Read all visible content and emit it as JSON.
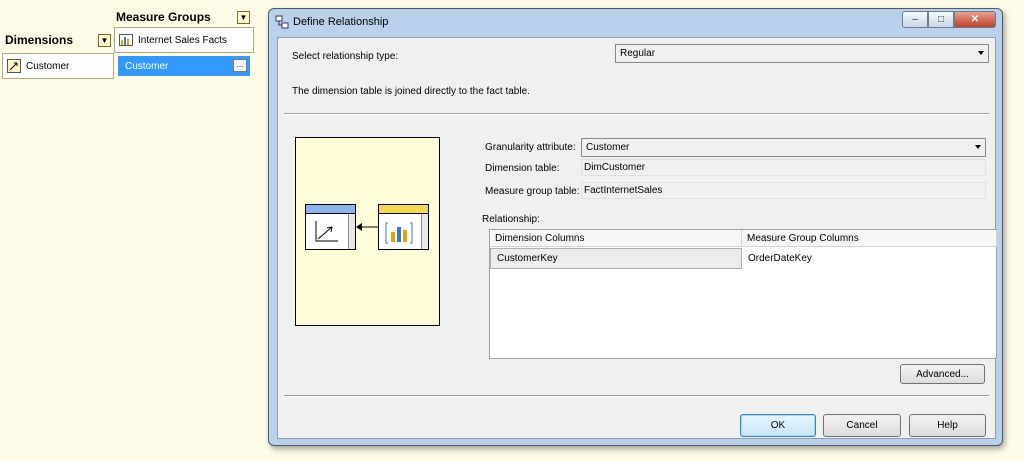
{
  "designer": {
    "measure_groups_header": "Measure Groups",
    "dimensions_header": "Dimensions",
    "measure_group_name": "Internet Sales Facts",
    "dimension_name": "Customer",
    "relationship_cell": "Customer",
    "ellipsis_label": "..."
  },
  "dialog": {
    "title": "Define Relationship",
    "window_buttons": {
      "minimize": "–",
      "maximize": "□",
      "close": "✕"
    },
    "relationship_type_label": "Select relationship type:",
    "relationship_type_value": "Regular",
    "description": "The dimension table is joined directly to the fact table.",
    "granularity_label": "Granularity attribute:",
    "granularity_value": "Customer",
    "dimension_table_label": "Dimension table:",
    "dimension_table_value": "DimCustomer",
    "measure_group_table_label": "Measure group table:",
    "measure_group_table_value": "FactInternetSales",
    "relationship_label": "Relationship:",
    "grid": {
      "columns": [
        "Dimension Columns",
        "Measure Group Columns"
      ],
      "rows": [
        [
          "CustomerKey",
          "OrderDateKey"
        ]
      ]
    },
    "advanced_button": "Advanced...",
    "ok_button": "OK",
    "cancel_button": "Cancel",
    "help_button": "Help"
  },
  "colors": {
    "background": "#fdfbe6",
    "selection": "#3399ff",
    "diagram_fill": "#fffed8",
    "dimension_header": "#8ab4f0",
    "fact_header": "#f5d84a"
  }
}
